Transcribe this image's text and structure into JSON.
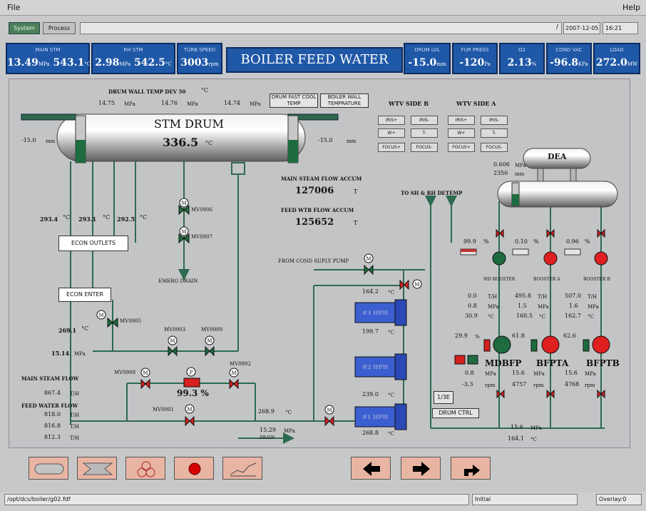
{
  "menu": {
    "file": "File",
    "help": "Help"
  },
  "toolbar": {
    "system": "System",
    "process": "Process",
    "date": "2007-12-05",
    "time": "16:21"
  },
  "header": {
    "title": "BOILER FEED WATER",
    "main_stm": {
      "label": "MAIN STM",
      "pressure": "13.49",
      "p_unit": "MPa",
      "temp": "543.1",
      "t_unit": "°C"
    },
    "rh_stm": {
      "label": "RH STM",
      "pressure": "2.98",
      "p_unit": "MPa",
      "temp": "542.5",
      "t_unit": "°C"
    },
    "turb_speed": {
      "label": "TURB SPEED",
      "value": "3003",
      "unit": "rpm"
    },
    "drum_lvl": {
      "label": "DRUM LVL",
      "value": "-15.0",
      "unit": "mm"
    },
    "fur_press": {
      "label": "FUR PRESS",
      "value": "-120",
      "unit": "Pa"
    },
    "o2": {
      "label": "O2",
      "value": "2.13",
      "unit": "%"
    },
    "cond_vac": {
      "label": "COND VAC",
      "value": "-96.8",
      "unit": "KPa"
    },
    "load": {
      "label": "LOAD",
      "value": "272.0",
      "unit": "MW"
    }
  },
  "drum": {
    "wall_temp_dev": "DRUM WALL TEMP DEV 50",
    "wall_temp_unit": "°C",
    "p1": "14.75",
    "p2": "14.76",
    "p3": "14.74",
    "p_unit": "MPa",
    "name": "STM DRUM",
    "temp": "336.5",
    "temp_unit": "°C",
    "lvl_left": "-15.0",
    "lvl_right": "-15.0",
    "lvl_unit": "mm",
    "fast_cool_btn": "DRUM FAST COOL TEMP",
    "wall_temp_btn": "BOILER WALL TEMPRATURE"
  },
  "wtv": {
    "side_b": "WTV SIDE B",
    "side_a": "WTV SIDE A",
    "buttons": [
      "IRIS+",
      "IRIS-",
      "W+",
      "T-",
      "FOCUS+",
      "FOCUS-"
    ]
  },
  "flow_accum": {
    "main_label": "MAIN STEAM FLOW ACCUM",
    "main_value": "127006",
    "main_unit": "T",
    "feed_label": "FEED WTR FLOW ACCUM",
    "feed_value": "125652",
    "feed_unit": "T"
  },
  "econ": {
    "outlet_temps": [
      "293.4",
      "293.1",
      "292.5"
    ],
    "temp_unit": "°C",
    "outlets_label": "ECON OUTLETS",
    "enter_label": "ECON ENTER",
    "enter_temp": "269.1",
    "pressure": "15.14",
    "p_unit": "MPa"
  },
  "valves": {
    "mv0906": "MV0906",
    "mv0907": "MV0907",
    "emerg_drain": "EMERG DRAIN",
    "mv0905": "MV0905",
    "mv0903": "MV0903",
    "mv0909": "MV0909",
    "mv0908": "MV0908",
    "mv0902": "MV0902",
    "mv0901": "MV0901",
    "control_pct": "99.3 %",
    "ctrl_mark": "P",
    "motor_mark": "M"
  },
  "main_flows": {
    "steam_label": "MAIN STEAM FLOW",
    "steam_value": "867.4",
    "steam_unit": "T/H",
    "feed_label": "FEED WATER FLOW",
    "feed_values": [
      "818.0",
      "816.8",
      "812.3"
    ],
    "feed_unit": "T/H"
  },
  "line": {
    "temp_after_hp": "268.9",
    "temp_unit": "°C",
    "pressure": "15.29",
    "p_unit": "MPa",
    "drain": "DRAIN",
    "from_cond": "FROM COND SUPLY PUMP",
    "to_sh": "TO SH & RH DETEMP"
  },
  "hph": {
    "names": [
      "#3 HPH",
      "#2 HPH",
      "#1 HPH"
    ],
    "temps": [
      "164.2",
      "199.7",
      "239.0",
      "268.8"
    ],
    "unit": "°C"
  },
  "dea": {
    "name": "DEA",
    "pressure": "0.606",
    "p_unit": "MPa",
    "level": "2356",
    "l_unit": "mm"
  },
  "boosters": [
    {
      "name": "MD BOOSTER",
      "pct": "99.9",
      "flow": "0.0",
      "press": "0.8",
      "temp": "30.9"
    },
    {
      "name": "BOOSTER A",
      "pct": "0.10",
      "flow": "495.8",
      "press": "1.5",
      "temp": "160.5"
    },
    {
      "name": "BOOSTER B",
      "pct": "0.96",
      "flow": "507.0",
      "press": "1.6",
      "temp": "162.7"
    }
  ],
  "pct_unit": "%",
  "flow_unit": "T/H",
  "press_unit": "MPa",
  "temp_unit": "°C",
  "rpm_unit": "rpm",
  "bfps": [
    {
      "name": "MDBFP",
      "scoop": "29.9",
      "press": "0.8",
      "speed": "-3.3"
    },
    {
      "name": "BFPTA",
      "scoop": "61.8",
      "press": "15.6",
      "speed": "4757"
    },
    {
      "name": "BFPTB",
      "scoop": "62.6",
      "press": "15.6",
      "speed": "4768"
    }
  ],
  "bfp_out": {
    "pressure": "15.6",
    "p_unit": "MPa",
    "temp": "164.1",
    "t_unit": "°C"
  },
  "aux_buttons": {
    "ratio": "1/3E",
    "drum_ctrl": "DRUM CTRL"
  },
  "status": {
    "path": "/opt/dcs/boiler/g02.fdf",
    "mode": "Initial",
    "overlay": "Overlay:0"
  },
  "colors": {
    "header_blue": "#1f58a6",
    "pipe_green": "#2e6a4f",
    "pump_red": "#e02020",
    "pump_green": "#1e6b40"
  }
}
